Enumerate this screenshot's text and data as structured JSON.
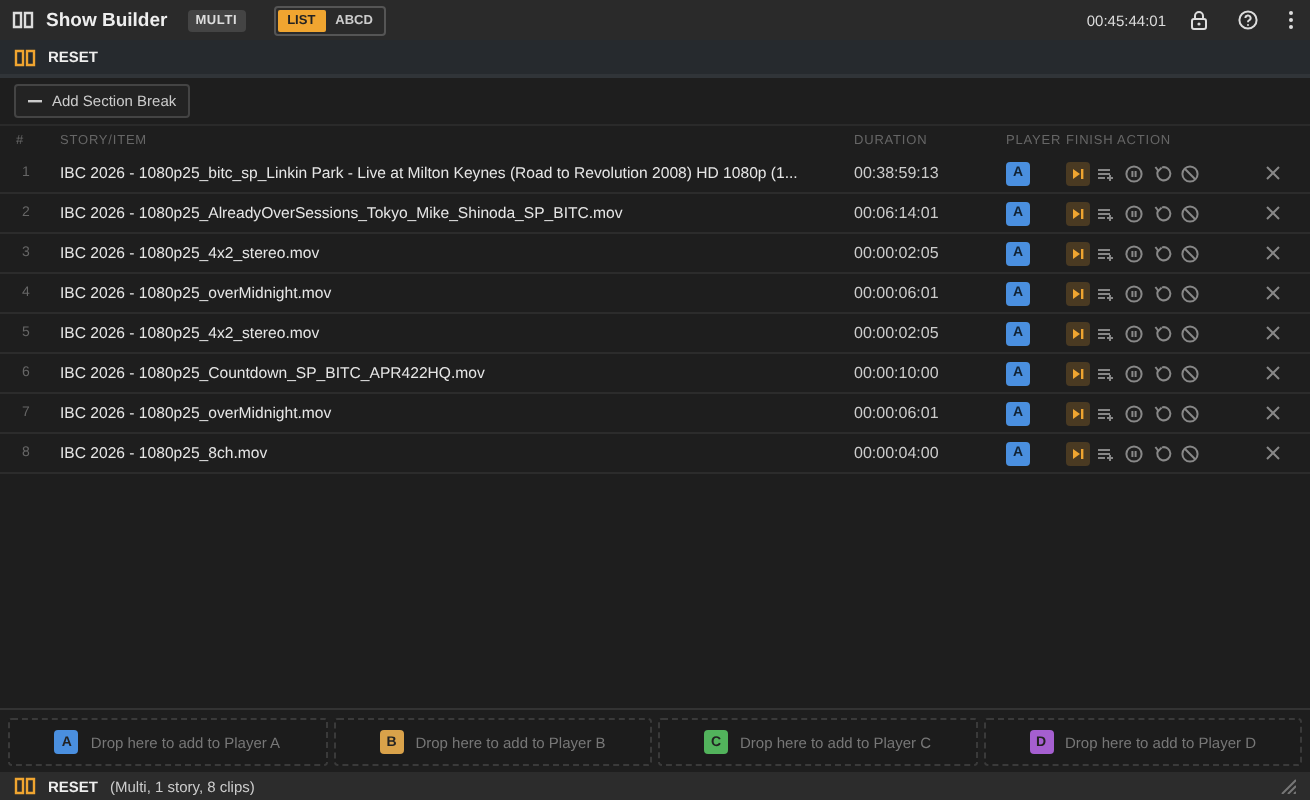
{
  "toolbar": {
    "title": "Show Builder",
    "mode_badge": "MULTI",
    "view_toggle": [
      {
        "label": "LIST",
        "selected": true
      },
      {
        "label": "ABCD",
        "selected": false
      }
    ],
    "total_duration": "00:45:44:01"
  },
  "show": {
    "name": "RESET"
  },
  "add_section_break": "Add Section Break",
  "table": {
    "columns": [
      "#",
      "STORY/ITEM",
      "DURATION",
      "PLAYER",
      "FINISH ACTION"
    ],
    "rows": [
      {
        "number": "1",
        "item": "IBC 2026 - 1080p25_bitc_sp_Linkin Park - Live at Milton Keynes (Road to Revolution 2008) HD 1080p (1...",
        "duration": "00:38:59:13",
        "player": {
          "label": "A",
          "color": "#4a8fdf"
        },
        "finish_actions": [
          {
            "kind": "next",
            "selected": true
          },
          {
            "kind": "queue",
            "selected": false
          },
          {
            "kind": "pause",
            "selected": false
          },
          {
            "kind": "loop",
            "selected": false
          },
          {
            "kind": "stop",
            "selected": false
          }
        ]
      },
      {
        "number": "2",
        "item": "IBC 2026 - 1080p25_AlreadyOverSessions_Tokyo_Mike_Shinoda_SP_BITC.mov",
        "duration": "00:06:14:01",
        "player": {
          "label": "A",
          "color": "#4a8fdf"
        },
        "finish_actions": [
          {
            "kind": "next",
            "selected": true
          },
          {
            "kind": "queue",
            "selected": false
          },
          {
            "kind": "pause",
            "selected": false
          },
          {
            "kind": "loop",
            "selected": false
          },
          {
            "kind": "stop",
            "selected": false
          }
        ]
      },
      {
        "number": "3",
        "item": "IBC 2026 - 1080p25_4x2_stereo.mov",
        "duration": "00:00:02:05",
        "player": {
          "label": "A",
          "color": "#4a8fdf"
        },
        "finish_actions": [
          {
            "kind": "next",
            "selected": true
          },
          {
            "kind": "queue",
            "selected": false
          },
          {
            "kind": "pause",
            "selected": false
          },
          {
            "kind": "loop",
            "selected": false
          },
          {
            "kind": "stop",
            "selected": false
          }
        ]
      },
      {
        "number": "4",
        "item": "IBC 2026 - 1080p25_overMidnight.mov",
        "duration": "00:00:06:01",
        "player": {
          "label": "A",
          "color": "#4a8fdf"
        },
        "finish_actions": [
          {
            "kind": "next",
            "selected": true
          },
          {
            "kind": "queue",
            "selected": false
          },
          {
            "kind": "pause",
            "selected": false
          },
          {
            "kind": "loop",
            "selected": false
          },
          {
            "kind": "stop",
            "selected": false
          }
        ]
      },
      {
        "number": "5",
        "item": "IBC 2026 - 1080p25_4x2_stereo.mov",
        "duration": "00:00:02:05",
        "player": {
          "label": "A",
          "color": "#4a8fdf"
        },
        "finish_actions": [
          {
            "kind": "next",
            "selected": true
          },
          {
            "kind": "queue",
            "selected": false
          },
          {
            "kind": "pause",
            "selected": false
          },
          {
            "kind": "loop",
            "selected": false
          },
          {
            "kind": "stop",
            "selected": false
          }
        ]
      },
      {
        "number": "6",
        "item": "IBC 2026 - 1080p25_Countdown_SP_BITC_APR422HQ.mov",
        "duration": "00:00:10:00",
        "player": {
          "label": "A",
          "color": "#4a8fdf"
        },
        "finish_actions": [
          {
            "kind": "next",
            "selected": true
          },
          {
            "kind": "queue",
            "selected": false
          },
          {
            "kind": "pause",
            "selected": false
          },
          {
            "kind": "loop",
            "selected": false
          },
          {
            "kind": "stop",
            "selected": false
          }
        ]
      },
      {
        "number": "7",
        "item": "IBC 2026 - 1080p25_overMidnight.mov",
        "duration": "00:00:06:01",
        "player": {
          "label": "A",
          "color": "#4a8fdf"
        },
        "finish_actions": [
          {
            "kind": "next",
            "selected": true
          },
          {
            "kind": "queue",
            "selected": false
          },
          {
            "kind": "pause",
            "selected": false
          },
          {
            "kind": "loop",
            "selected": false
          },
          {
            "kind": "stop",
            "selected": false
          }
        ]
      },
      {
        "number": "8",
        "item": "IBC 2026 - 1080p25_8ch.mov",
        "duration": "00:00:04:00",
        "player": {
          "label": "A",
          "color": "#4a8fdf"
        },
        "finish_actions": [
          {
            "kind": "next",
            "selected": true
          },
          {
            "kind": "queue",
            "selected": false
          },
          {
            "kind": "pause",
            "selected": false
          },
          {
            "kind": "loop",
            "selected": false
          },
          {
            "kind": "stop",
            "selected": false
          }
        ]
      }
    ]
  },
  "drop_zones": [
    {
      "letter": "A",
      "label": "Drop here to add to Player A",
      "color": "#4a8fdf"
    },
    {
      "letter": "B",
      "label": "Drop here to add to Player B",
      "color": "#d9a24a"
    },
    {
      "letter": "C",
      "label": "Drop here to add to Player C",
      "color": "#52b35c"
    },
    {
      "letter": "D",
      "label": "Drop here to add to Player D",
      "color": "#a55fd0"
    }
  ],
  "status_bar": {
    "show": "RESET",
    "summary": "(Multi, 1 story, 8 clips)"
  }
}
